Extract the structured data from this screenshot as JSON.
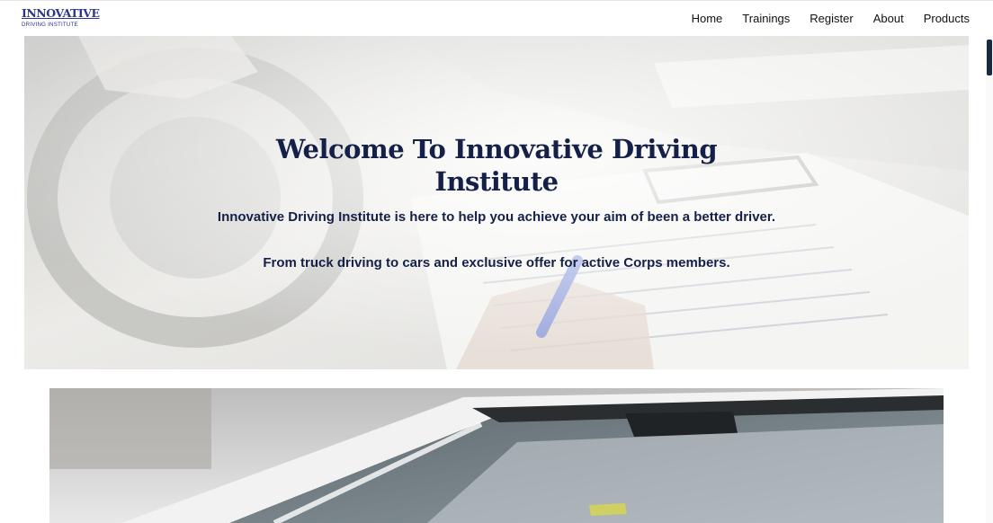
{
  "brand": {
    "logo_word": "INNOVATIVE",
    "logo_tagline": "DRIVING INSTITUTE",
    "color": "#2b3490"
  },
  "nav": {
    "items": [
      {
        "label": "Home"
      },
      {
        "label": "Trainings"
      },
      {
        "label": "Register"
      },
      {
        "label": "About"
      },
      {
        "label": "Products"
      }
    ]
  },
  "hero": {
    "title": "Welcome To Innovative Driving Institute",
    "subtitle": "Innovative Driving Institute is here to help you achieve your aim of been a better driver.",
    "offer": "From truck driving to cars and exclusive offer for active Corps members.",
    "image": "driver-filling-form-in-car-photo",
    "text_color": "#152048"
  },
  "banner": {
    "image": "car-windshield-photo"
  }
}
